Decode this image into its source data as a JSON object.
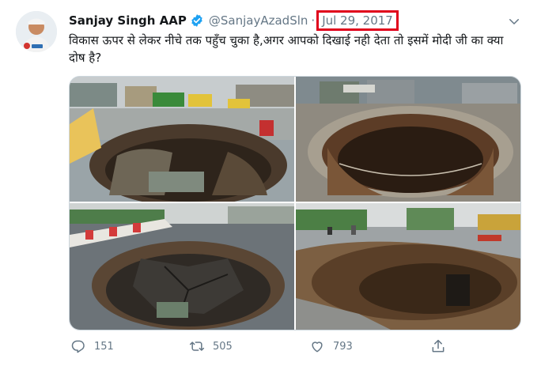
{
  "tweet": {
    "display_name": "Sanjay Singh AAP",
    "handle": "@SanjayAzadSln",
    "separator": "·",
    "date": "Jul 29, 2017",
    "text": "विकास ऊपर से लेकर नीचे तक पहुँच चुका है,अगर आपको दिखाई नही देता तो इसमें मोदी जी का क्या दोष है?"
  },
  "actions": {
    "reply_count": "151",
    "retweet_count": "505",
    "like_count": "793"
  },
  "colors": {
    "date_highlight": "#e0001b",
    "verified_badge": "#1da1f2",
    "muted_text": "#657786"
  },
  "icons": {
    "verified": "verified-badge-icon",
    "more": "chevron-down-icon",
    "reply": "reply-icon",
    "retweet": "retweet-icon",
    "like": "heart-icon",
    "share": "share-icon"
  }
}
